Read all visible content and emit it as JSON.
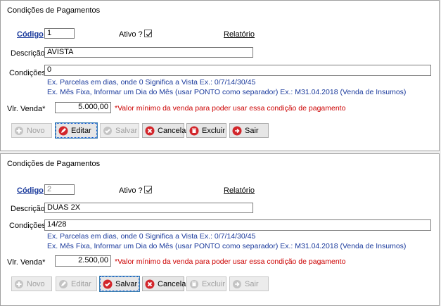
{
  "panels": [
    {
      "title": "Condições de Pagamentos",
      "codigo_label": "Código",
      "codigo_value": "1",
      "ativo_label": "Ativo ?",
      "relatorio_label": "Relatório",
      "descricao_label": "Descrição",
      "descricao_value": "AVISTA",
      "condicoes_label": "Condições",
      "condicoes_value": "0",
      "hint1": "Ex. Parcelas em dias, onde 0 Significa a Vista Ex.:  0/7/14/30/45",
      "hint2": "Ex. Mês Fixa, Informar um Dia do Mês (usar PONTO como separador) Ex.:  M31.04.2018 (Venda de Insumos)",
      "vlvenda_label": "Vlr. Venda*",
      "vlvenda_value": "5.000,00",
      "warning": "*Valor mínimo da venda para poder usar essa condição de pagamento",
      "buttons": {
        "novo": "Novo",
        "editar": "Editar",
        "salvar": "Salvar",
        "cancelar": "Cancelar",
        "excluir": "Excluir",
        "sair": "Sair"
      }
    },
    {
      "title": "Condições de Pagamentos",
      "codigo_label": "Código",
      "codigo_value": "2",
      "ativo_label": "Ativo ?",
      "relatorio_label": "Relatório",
      "descricao_label": "Descrição",
      "descricao_value": "DUAS 2X",
      "condicoes_label": "Condições",
      "condicoes_value": "14/28",
      "hint1": "Ex. Parcelas em dias, onde 0 Significa a Vista Ex.:  0/7/14/30/45",
      "hint2": "Ex. Mês Fixa, Informar um Dia do Mês (usar PONTO como separador) Ex.:  M31.04.2018 (Venda de Insumos)",
      "vlvenda_label": "Vlr. Venda*",
      "vlvenda_value": "2.500,00",
      "warning": "*Valor mínimo da venda para poder usar essa condição de pagamento",
      "buttons": {
        "novo": "Novo",
        "editar": "Editar",
        "salvar": "Salvar",
        "cancelar": "Cancelar",
        "excluir": "Excluir",
        "sair": "Sair"
      }
    }
  ],
  "colors": {
    "link": "#1a3a9c",
    "hint": "#1a3a9c",
    "warning": "#cc0000",
    "button_red": "#d2262b",
    "button_green": "#2e9a3c",
    "disabled": "#a0a0a0"
  }
}
